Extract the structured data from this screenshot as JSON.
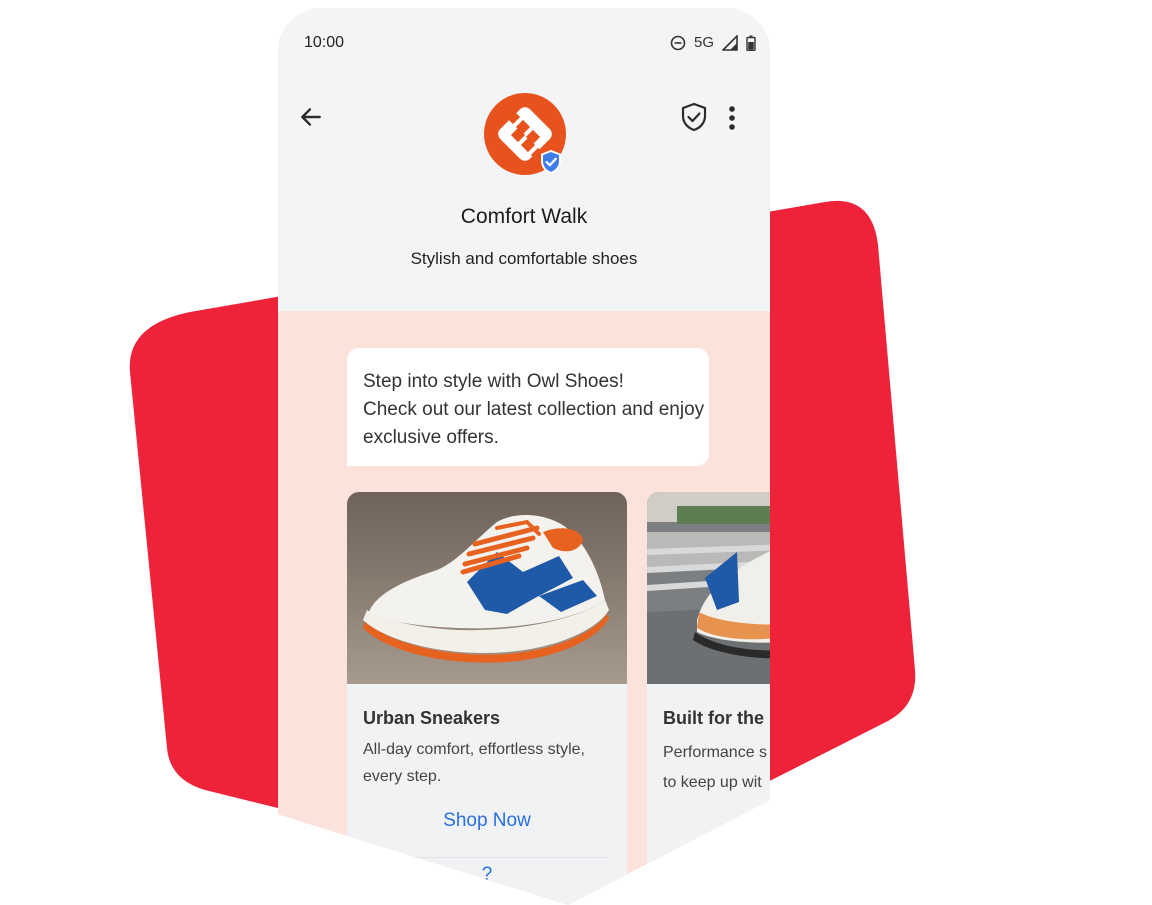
{
  "status_bar": {
    "time": "10:00",
    "network": "5G"
  },
  "header": {
    "brand_name": "Comfort Walk",
    "tagline": "Stylish and comfortable shoes"
  },
  "message": {
    "lines": [
      "Step into style with Owl Shoes!",
      "Check out our latest collection and enjoy",
      "exclusive offers."
    ]
  },
  "cards": [
    {
      "title": "Urban Sneakers",
      "description": "All-day comfort, effortless style, every step.",
      "action": "Shop Now",
      "action2": "?"
    },
    {
      "title": "Built for the",
      "description_lines": [
        "Performance s",
        "to keep up wit"
      ]
    }
  ],
  "colors": {
    "backdrop_red": "#ee2339",
    "chat_background": "#fbe3dc",
    "header_background": "#f2f4f6",
    "brand_orange": "#e8521c",
    "verified_blue": "#3f7ee8",
    "link_blue": "#2a6ee0"
  },
  "icons": {
    "back": "arrow-left-icon",
    "verified": "shield-check-icon",
    "menu": "more-vert-icon",
    "dnd": "do-not-disturb-icon",
    "signal": "signal-icon",
    "battery": "battery-icon"
  }
}
